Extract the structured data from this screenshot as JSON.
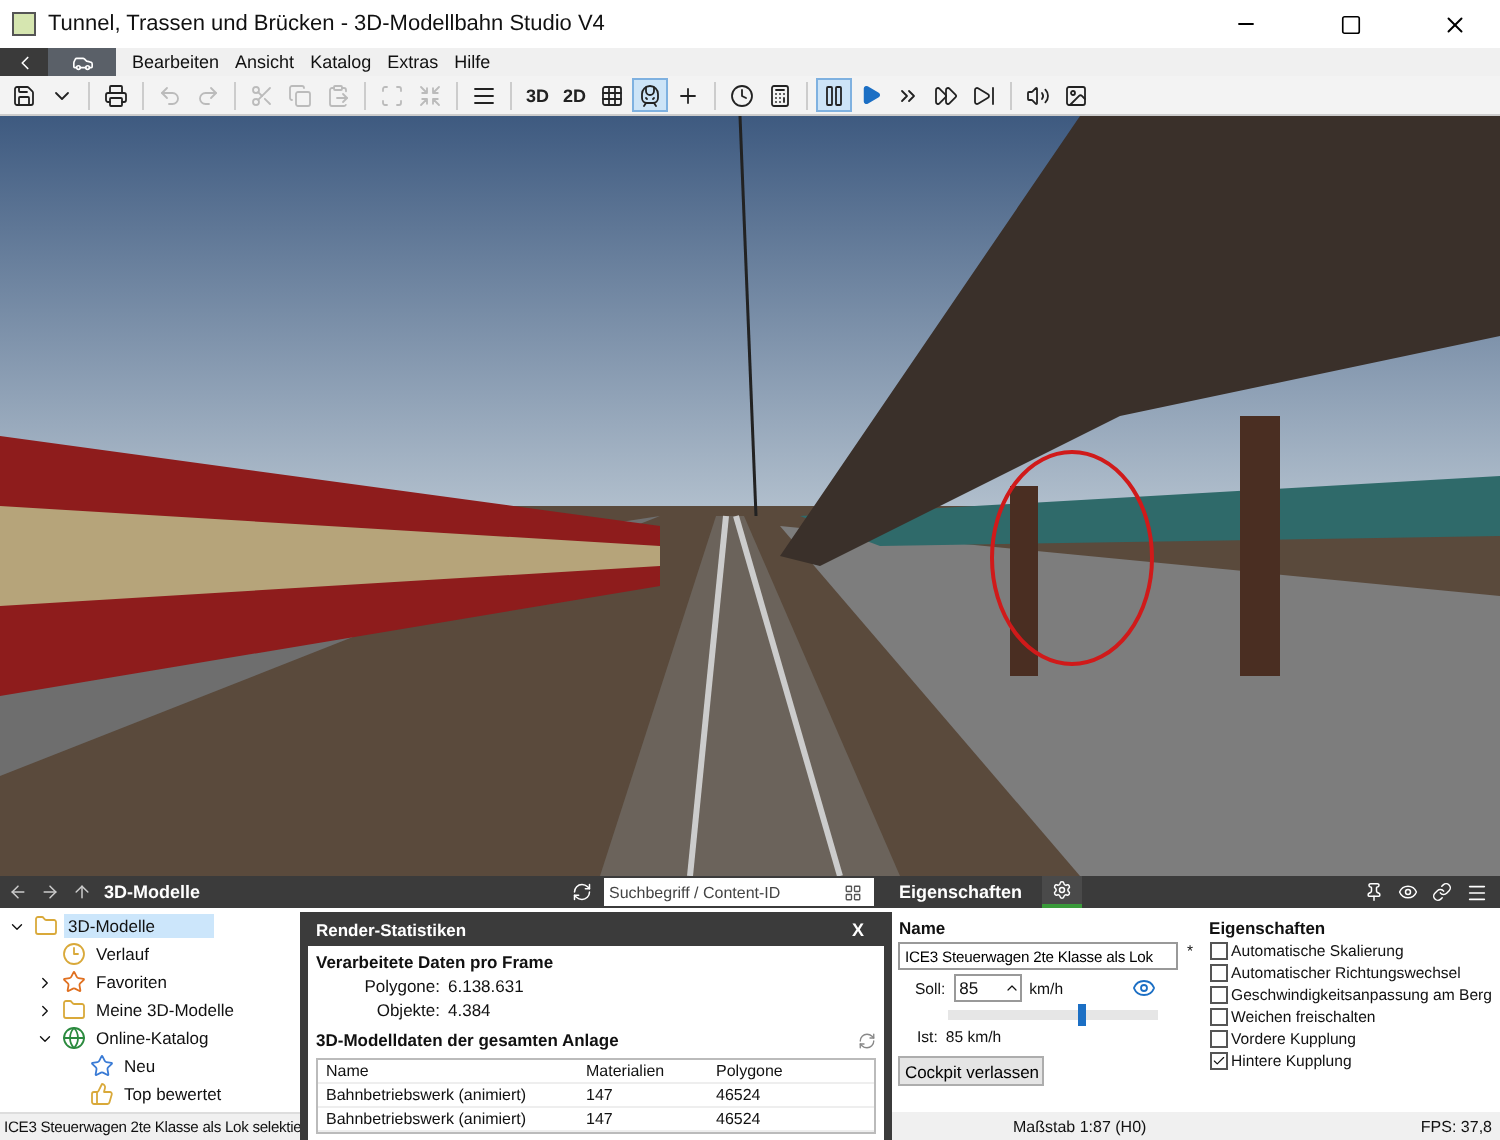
{
  "window": {
    "title": "Tunnel, Trassen und Brücken - 3D-Modellbahn Studio V4"
  },
  "menu": [
    {
      "label": "Bearbeiten"
    },
    {
      "label": "Ansicht"
    },
    {
      "label": "Katalog"
    },
    {
      "label": "Extras"
    },
    {
      "label": "Hilfe"
    }
  ],
  "toolbar": {
    "view_labels": [
      "3D",
      "2D"
    ],
    "grid_on": false,
    "cockpit_on": true,
    "paused": true
  },
  "viewport": {
    "highlight_circle": true
  },
  "catalog": {
    "title": "3D-Modelle",
    "search": {
      "placeholder": "Suchbegriff / Content-ID"
    },
    "tree": [
      {
        "label": "3D-Modelle",
        "kind": "folder",
        "expanded": true,
        "selected": true,
        "children": [
          {
            "label": "Verlauf",
            "kind": "history",
            "selected": false
          },
          {
            "label": "Favoriten",
            "kind": "favorites",
            "expanded": false,
            "selected": false
          },
          {
            "label": "Meine 3D-Modelle",
            "kind": "folder",
            "expanded": false,
            "selected": false
          },
          {
            "label": "Online-Katalog",
            "kind": "globe",
            "expanded": true,
            "selected": false,
            "children": [
              {
                "label": "Neu",
                "kind": "new",
                "selected": false
              },
              {
                "label": "Top bewertet",
                "kind": "top",
                "selected": false
              }
            ]
          }
        ]
      }
    ],
    "status": "ICE3 Steuerwagen 2te Klasse als Lok selektie"
  },
  "render_stats": {
    "title": "Render-Statistiken",
    "close": "X",
    "frame_heading": "Verarbeitete Daten pro Frame",
    "frame_stats": [
      {
        "label": "Polygone:",
        "value": "6.138.631"
      },
      {
        "label": "Objekte:",
        "value": "4.384"
      }
    ],
    "model_heading": "3D-Modelldaten der gesamten Anlage",
    "columns": [
      "Name",
      "Materialien",
      "Polygone"
    ],
    "rows": [
      [
        "Bahnbetriebswerk (animiert)",
        "147",
        "46524"
      ],
      [
        "Bahnbetriebswerk (animiert)",
        "147",
        "46524"
      ]
    ]
  },
  "properties": {
    "tab": "Eigenschaften",
    "name_heading": "Name",
    "name_value": "ICE3 Steuerwagen 2te Klasse als Lok",
    "modified_mark": "*",
    "target_label": "Soll:",
    "target_value": "85",
    "unit": "km/h",
    "speed_slider": {
      "level": 0.63
    },
    "actual_label": "Ist:",
    "actual_value": "85 km/h",
    "leave_button": "Cockpit verlassen",
    "options_heading": "Eigenschaften",
    "options": [
      {
        "label": "Automatische Skalierung",
        "checked": false
      },
      {
        "label": "Automatischer Richtungswechsel",
        "checked": false
      },
      {
        "label": "Geschwindigkeitsanpassung am Berg",
        "checked": false
      },
      {
        "label": "Weichen freischalten",
        "checked": false
      },
      {
        "label": "Vordere Kupplung",
        "checked": false
      },
      {
        "label": "Hintere Kupplung",
        "checked": true
      }
    ],
    "scale": "Maßstab 1:87 (H0)",
    "fps": "FPS: 37,8"
  }
}
